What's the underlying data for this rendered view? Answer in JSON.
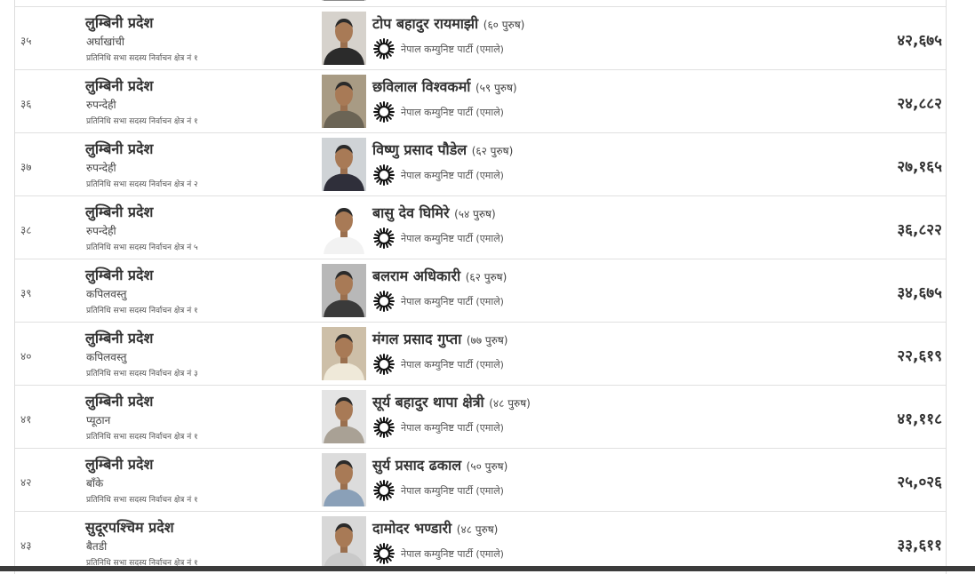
{
  "rows": [
    {
      "sn": "",
      "province": "",
      "district": "",
      "constituency": "",
      "candidate": "",
      "age_gender": "",
      "party": "",
      "votes": "",
      "shirt": "#8a8a8a",
      "bg": "#d8d8d8"
    },
    {
      "sn": "३५",
      "province": "लुम्बिनी प्रदेश",
      "district": "अर्घाखांची",
      "constituency": "प्रतिनिधि सभा सदस्य निर्वाचन क्षेत्र नं १",
      "candidate": "टोप बहादुर रायमाझी",
      "age_gender": "(६० पुरुष)",
      "party": "नेपाल कम्युनिष्ट पार्टी (एमाले)",
      "votes": "४२,६७५",
      "shirt": "#2b2b2b",
      "bg": "#d6d2cc"
    },
    {
      "sn": "३६",
      "province": "लुम्बिनी प्रदेश",
      "district": "रुपन्देही",
      "constituency": "प्रतिनिधि सभा सदस्य निर्वाचन क्षेत्र नं १",
      "candidate": "छविलाल विश्वकर्मा",
      "age_gender": "(५९ पुरुष)",
      "party": "नेपाल कम्युनिष्ट पार्टी (एमाले)",
      "votes": "२४,८८२",
      "shirt": "#6b6455",
      "bg": "#a89b84"
    },
    {
      "sn": "३७",
      "province": "लुम्बिनी प्रदेश",
      "district": "रुपन्देही",
      "constituency": "प्रतिनिधि सभा सदस्य निर्वाचन क्षेत्र नं २",
      "candidate": "विष्णु प्रसाद पौडेल",
      "age_gender": "(६२ पुरुष)",
      "party": "नेपाल कम्युनिष्ट पार्टी (एमाले)",
      "votes": "२७,१६५",
      "shirt": "#2f2f3a",
      "bg": "#cfd3d6"
    },
    {
      "sn": "३८",
      "province": "लुम्बिनी प्रदेश",
      "district": "रुपन्देही",
      "constituency": "प्रतिनिधि सभा सदस्य निर्वाचन क्षेत्र नं ५",
      "candidate": "बासु देव घिमिरे",
      "age_gender": "(५४ पुरुष)",
      "party": "नेपाल कम्युनिष्ट पार्टी (एमाले)",
      "votes": "३६,८२२",
      "shirt": "#f2f2f2",
      "bg": "#ffffff"
    },
    {
      "sn": "३९",
      "province": "लुम्बिनी प्रदेश",
      "district": "कपिलवस्तु",
      "constituency": "प्रतिनिधि सभा सदस्य निर्वाचन क्षेत्र नं १",
      "candidate": "बलराम अधिकारी",
      "age_gender": "(६२ पुरुष)",
      "party": "नेपाल कम्युनिष्ट पार्टी (एमाले)",
      "votes": "३४,६७५",
      "shirt": "#3a3a3a",
      "bg": "#b8b8b8"
    },
    {
      "sn": "४०",
      "province": "लुम्बिनी प्रदेश",
      "district": "कपिलवस्तु",
      "constituency": "प्रतिनिधि सभा सदस्य निर्वाचन क्षेत्र नं ३",
      "candidate": "मंगल प्रसाद गुप्ता",
      "age_gender": "(७७ पुरुष)",
      "party": "नेपाल कम्युनिष्ट पार्टी (एमाले)",
      "votes": "२२,६१९",
      "shirt": "#efe9d9",
      "bg": "#cdbfa8"
    },
    {
      "sn": "४१",
      "province": "लुम्बिनी प्रदेश",
      "district": "प्यूठान",
      "constituency": "प्रतिनिधि सभा सदस्य निर्वाचन क्षेत्र नं १",
      "candidate": "सूर्य बहादुर थापा क्षेत्री",
      "age_gender": "(४८ पुरुष)",
      "party": "नेपाल कम्युनिष्ट पार्टी (एमाले)",
      "votes": "४१,११८",
      "shirt": "#a9a195",
      "bg": "#e4e4e4"
    },
    {
      "sn": "४२",
      "province": "लुम्बिनी प्रदेश",
      "district": "बाँके",
      "constituency": "प्रतिनिधि सभा सदस्य निर्वाचन क्षेत्र नं १",
      "candidate": "सुर्य प्रसाद ढकाल",
      "age_gender": "(५० पुरुष)",
      "party": "नेपाल कम्युनिष्ट पार्टी (एमाले)",
      "votes": "२५,०२६",
      "shirt": "#8aa0b8",
      "bg": "#dcdcdc"
    },
    {
      "sn": "४३",
      "province": "सुदूरपश्चिम प्रदेश",
      "district": "बैतडी",
      "constituency": "प्रतिनिधि सभा सदस्य निर्वाचन क्षेत्र नं १",
      "candidate": "दामोदर भण्डारी",
      "age_gender": "(४८ पुरुष)",
      "party": "नेपाल कम्युनिष्ट पार्टी (एमाले)",
      "votes": "३३,६११",
      "shirt": "#c9c9c9",
      "bg": "#d8d8d8"
    }
  ]
}
